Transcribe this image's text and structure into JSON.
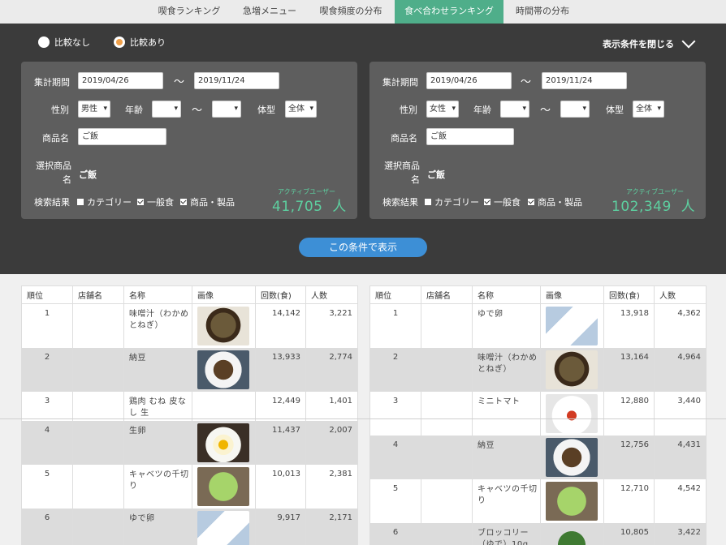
{
  "tabs": [
    {
      "label": "喫食ランキング",
      "active": false
    },
    {
      "label": "急増メニュー",
      "active": false
    },
    {
      "label": "喫食頻度の分布",
      "active": false
    },
    {
      "label": "食べ合わせランキング",
      "active": true
    },
    {
      "label": "時間帯の分布",
      "active": false
    }
  ],
  "compare": {
    "off_label": "比較なし",
    "on_label": "比較あり",
    "selected": "on"
  },
  "close_conditions_label": "表示条件を閉じる",
  "labels": {
    "period": "集計期間",
    "gender": "性別",
    "age": "年齢",
    "body": "体型",
    "product": "商品名",
    "selected_product": "選択商品名",
    "search_result": "検索結果",
    "tilde": "〜",
    "active_users": "アクティブユーザー",
    "people_unit": "人",
    "check_category": "カテゴリー",
    "check_general": "一般食",
    "check_product": "商品・製品"
  },
  "panels": [
    {
      "period_from": "2019/04/26",
      "period_to": "2019/11/24",
      "gender": "男性",
      "age_from": "",
      "age_to": "",
      "body": "全体",
      "product": "ご飯",
      "selected_product": "ご飯",
      "check_category": false,
      "check_general": true,
      "check_product": true,
      "active_users": "41,705"
    },
    {
      "period_from": "2019/04/26",
      "period_to": "2019/11/24",
      "gender": "女性",
      "age_from": "",
      "age_to": "",
      "body": "全体",
      "product": "ご飯",
      "selected_product": "ご飯",
      "check_category": false,
      "check_general": true,
      "check_product": true,
      "active_users": "102,349"
    }
  ],
  "show_button_label": "この条件で表示",
  "table_headers": [
    "順位",
    "店舗名",
    "名称",
    "画像",
    "回数(食)",
    "人数"
  ],
  "tables": [
    {
      "rows": [
        {
          "rank": "1",
          "store": "",
          "name": "味噌汁（わかめとねぎ）",
          "image": "miso-soup-icon",
          "count": "14,142",
          "people": "3,221"
        },
        {
          "rank": "2",
          "store": "",
          "name": "納豆",
          "image": "natto-icon",
          "count": "13,933",
          "people": "2,774"
        },
        {
          "rank": "3",
          "store": "",
          "name": "鶏肉 むね 皮なし 生",
          "image": "",
          "count": "12,449",
          "people": "1,401"
        },
        {
          "rank": "4",
          "store": "",
          "name": "生卵",
          "image": "raw-egg-icon",
          "count": "11,437",
          "people": "2,007"
        },
        {
          "rank": "5",
          "store": "",
          "name": "キャベツの千切り",
          "image": "shredded-cabbage-icon",
          "count": "10,013",
          "people": "2,381"
        },
        {
          "rank": "6",
          "store": "",
          "name": "ゆで卵",
          "image": "boiled-egg-icon",
          "count": "9,917",
          "people": "2,171"
        }
      ]
    },
    {
      "rows": [
        {
          "rank": "1",
          "store": "",
          "name": "ゆで卵",
          "image": "boiled-egg-icon",
          "count": "13,918",
          "people": "4,362"
        },
        {
          "rank": "2",
          "store": "",
          "name": "味噌汁（わかめとねぎ）",
          "image": "miso-soup-icon",
          "count": "13,164",
          "people": "4,964"
        },
        {
          "rank": "3",
          "store": "",
          "name": "ミニトマト",
          "image": "cherry-tomato-icon",
          "count": "12,880",
          "people": "3,440"
        },
        {
          "rank": "4",
          "store": "",
          "name": "納豆",
          "image": "natto-icon",
          "count": "12,756",
          "people": "4,431"
        },
        {
          "rank": "5",
          "store": "",
          "name": "キャベツの千切り",
          "image": "shredded-cabbage-icon",
          "count": "12,710",
          "people": "4,542"
        },
        {
          "rank": "6",
          "store": "",
          "name": "ブロッコリー（ゆで）10g",
          "image": "broccoli-icon",
          "count": "10,805",
          "people": "3,422"
        }
      ]
    }
  ]
}
